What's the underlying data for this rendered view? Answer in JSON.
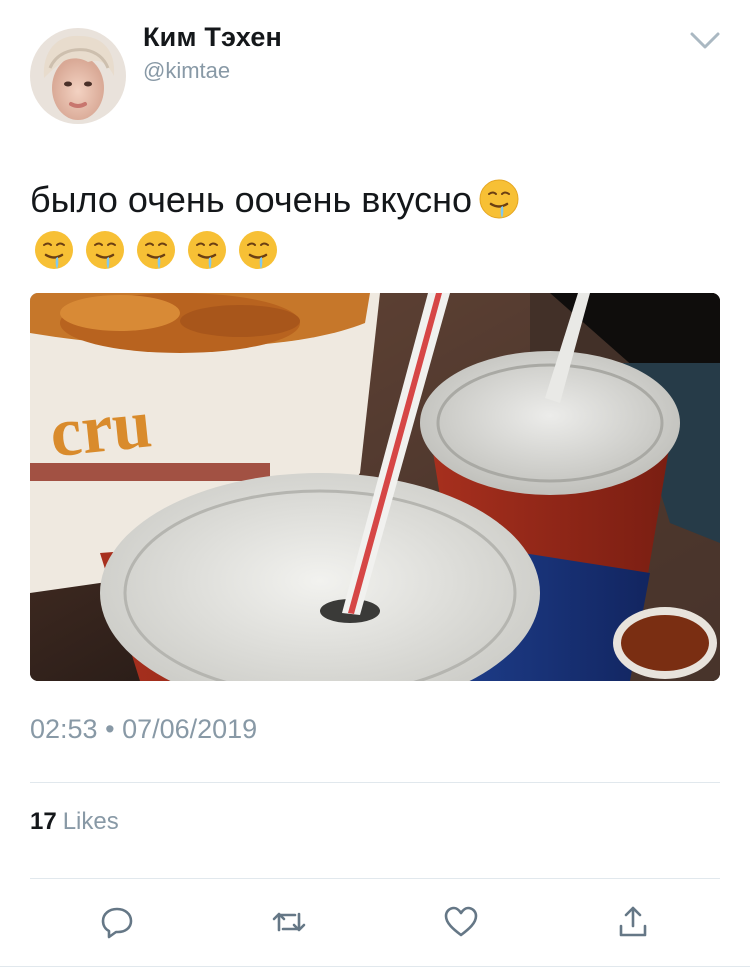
{
  "author": {
    "display_name": "Ким Тэхен",
    "handle": "@kimtae",
    "avatar_icon": "profile-photo"
  },
  "tweet": {
    "text": "было очень оочень вкусно",
    "emoji": "drooling-face",
    "emoji_count_line2": 5,
    "media_description_icon": "photo-drinks-and-chicken"
  },
  "meta": {
    "time": "02:53",
    "separator": "•",
    "date": "07/06/2019"
  },
  "stats": {
    "likes_count": "17",
    "likes_label": "Likes"
  },
  "actions": {
    "reply_icon": "reply-icon",
    "retweet_icon": "retweet-icon",
    "like_icon": "heart-icon",
    "share_icon": "share-icon"
  },
  "colors": {
    "text_primary": "#14171a",
    "text_secondary": "#8899a6",
    "divider": "#e1e8ed",
    "icon": "#657786"
  }
}
